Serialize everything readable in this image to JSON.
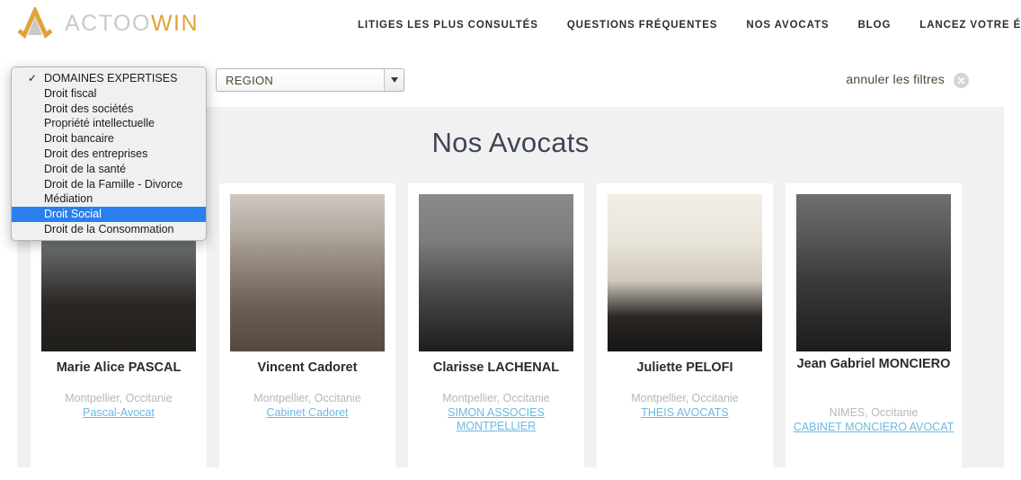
{
  "brand": {
    "name_part1": "ACTOO",
    "name_part2": "WIN",
    "logo_icon": "actoowin-logo-icon",
    "accent_color": "#e0a33c",
    "muted_color": "#c9c9c9"
  },
  "nav": {
    "items": [
      {
        "label": "LITIGES LES PLUS CONSULTÉS",
        "active": false
      },
      {
        "label": "QUESTIONS FRÉQUENTES",
        "active": false
      },
      {
        "label": "NOS AVOCATS",
        "active": true
      },
      {
        "label": "BLOG",
        "active": false
      },
      {
        "label": "LANCEZ VOTRE ÉTUDE",
        "active": false
      }
    ]
  },
  "filters": {
    "domaines_select_value": "DOMAINES EXPERTISES",
    "region_select_value": "REGION",
    "reset_label": "annuler les filtres",
    "reset_icon": "close-circle-icon",
    "dropdown_arrow_icon": "chevron-down-icon",
    "dropdown_open": true,
    "dropdown_items": [
      {
        "label": "DOMAINES EXPERTISES",
        "checked": true,
        "selected": false
      },
      {
        "label": "Droit fiscal",
        "checked": false,
        "selected": false
      },
      {
        "label": "Droit des sociétés",
        "checked": false,
        "selected": false
      },
      {
        "label": "Propriété intellectuelle",
        "checked": false,
        "selected": false
      },
      {
        "label": "Droit bancaire",
        "checked": false,
        "selected": false
      },
      {
        "label": "Droit des entreprises",
        "checked": false,
        "selected": false
      },
      {
        "label": "Droit de la santé",
        "checked": false,
        "selected": false
      },
      {
        "label": "Droit de la Famille - Divorce",
        "checked": false,
        "selected": false
      },
      {
        "label": "Médiation",
        "checked": false,
        "selected": false
      },
      {
        "label": "Droit Social",
        "checked": false,
        "selected": true
      },
      {
        "label": "Droit de la Consommation",
        "checked": false,
        "selected": false
      }
    ]
  },
  "main": {
    "title": "Nos Avocats",
    "lawyers": [
      {
        "name": "Marie Alice PASCAL",
        "location": "Montpellier, Occitanie",
        "firm": "Pascal-Avocat",
        "photo": "portrait-marie-alice-pascal"
      },
      {
        "name": "Vincent Cadoret",
        "location": "Montpellier, Occitanie",
        "firm": "Cabinet Cadoret",
        "photo": "portrait-vincent-cadoret"
      },
      {
        "name": "Clarisse LACHENAL",
        "location": "Montpellier, Occitanie",
        "firm": "SIMON ASSOCIES MONTPELLIER",
        "photo": "portrait-clarisse-lachenal"
      },
      {
        "name": "Juliette PELOFI",
        "location": "Montpellier, Occitanie",
        "firm": "THEIS AVOCATS",
        "photo": "portrait-juliette-pelofi"
      },
      {
        "name": "Jean Gabriel MONCIERO",
        "location": "NIMES, Occitanie",
        "firm": "CABINET MONCIERO AVOCAT",
        "photo": "portrait-jean-gabriel-monciero"
      }
    ]
  }
}
